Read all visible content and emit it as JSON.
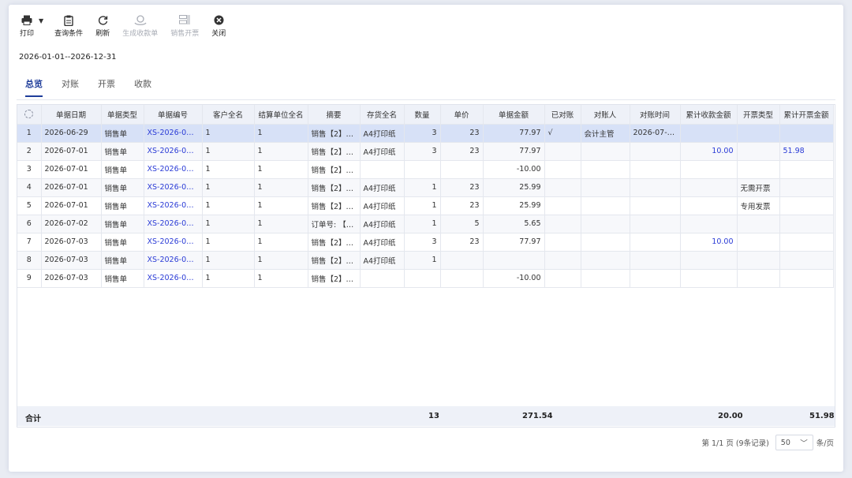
{
  "toolbar": {
    "print": {
      "label": "打印",
      "icon": "printer-icon"
    },
    "query": {
      "label": "查询条件",
      "icon": "clipboard-icon"
    },
    "refresh": {
      "label": "刷新",
      "icon": "refresh-icon"
    },
    "receipt": {
      "label": "生成收款单",
      "icon": "coin-stack-icon",
      "disabled": true
    },
    "invoice": {
      "label": "销售开票",
      "icon": "invoice-icon",
      "disabled": true
    },
    "close": {
      "label": "关闭",
      "icon": "close-circle-icon"
    }
  },
  "date_range": "2026-01-01--2026-12-31",
  "tabs": [
    {
      "label": "总览",
      "active": true
    },
    {
      "label": "对账",
      "active": false
    },
    {
      "label": "开票",
      "active": false
    },
    {
      "label": "收款",
      "active": false
    }
  ],
  "table": {
    "columns": [
      "",
      "单据日期",
      "单据类型",
      "单据编号",
      "客户全名",
      "结算单位全名",
      "摘要",
      "存货全名",
      "数量",
      "单价",
      "单据金额",
      "已对账",
      "对账人",
      "对账时间",
      "累计收款金额",
      "开票类型",
      "累计开票金额"
    ],
    "rows": [
      [
        "1",
        "2026-06-29",
        "销售单",
        "XS-2026-06-...",
        "1",
        "1",
        "销售【2】等...",
        "A4打印纸",
        "3",
        "23",
        "77.97",
        "√",
        "会计主管",
        "2026-07-0...",
        "",
        "",
        ""
      ],
      [
        "2",
        "2026-07-01",
        "销售单",
        "XS-2026-07-...",
        "1",
        "1",
        "销售【2】等...",
        "A4打印纸",
        "3",
        "23",
        "77.97",
        "",
        "",
        "",
        "10.00",
        "",
        "51.98"
      ],
      [
        "3",
        "2026-07-01",
        "销售单",
        "XS-2026-07-...",
        "1",
        "1",
        "销售【2】等...",
        "",
        "",
        "",
        "-10.00",
        "",
        "",
        "",
        "",
        "",
        ""
      ],
      [
        "4",
        "2026-07-01",
        "销售单",
        "XS-2026-07-...",
        "1",
        "1",
        "销售【2】等...",
        "A4打印纸",
        "1",
        "23",
        "25.99",
        "",
        "",
        "",
        "",
        "无需开票",
        ""
      ],
      [
        "5",
        "2026-07-01",
        "销售单",
        "XS-2026-07-...",
        "1",
        "1",
        "销售【2】等...",
        "A4打印纸",
        "1",
        "23",
        "25.99",
        "",
        "",
        "",
        "",
        "专用发票",
        ""
      ],
      [
        "6",
        "2026-07-02",
        "销售单",
        "XS-2026-07-...",
        "1",
        "1",
        "订单号: 【S...",
        "A4打印纸",
        "1",
        "5",
        "5.65",
        "",
        "",
        "",
        "",
        "",
        ""
      ],
      [
        "7",
        "2026-07-03",
        "销售单",
        "XS-2026-07-...",
        "1",
        "1",
        "销售【2】等...",
        "A4打印纸",
        "3",
        "23",
        "77.97",
        "",
        "",
        "",
        "10.00",
        "",
        ""
      ],
      [
        "8",
        "2026-07-03",
        "销售单",
        "XS-2026-07-...",
        "1",
        "1",
        "销售【2】等...",
        "A4打印纸",
        "1",
        "",
        "",
        "",
        "",
        "",
        "",
        "",
        ""
      ],
      [
        "9",
        "2026-07-03",
        "销售单",
        "XS-2026-07-...",
        "1",
        "1",
        "销售【2】等...",
        "",
        "",
        "",
        "-10.00",
        "",
        "",
        "",
        "",
        "",
        ""
      ]
    ],
    "selected_row": 1
  },
  "summary": {
    "label": "合计",
    "quantity": "13",
    "amount": "271.54",
    "received": "20.00",
    "invoiced": "51.98"
  },
  "pager": {
    "info": "第 1/1 页 (9条记录)",
    "page_size": "50",
    "unit": "条/页"
  },
  "colors": {
    "accent": "#1f3d9a",
    "link": "#2a3bd6",
    "selected_row": "#d7e1f7",
    "header_bg": "#eef1f8"
  }
}
